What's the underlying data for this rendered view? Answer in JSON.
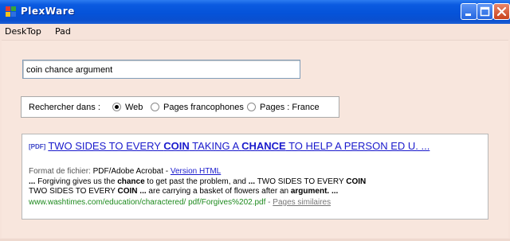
{
  "window": {
    "title": "PlexWare"
  },
  "menu": {
    "items": [
      "DeskTop",
      "Pad"
    ]
  },
  "search": {
    "value": "coin chance argument"
  },
  "search_in": {
    "label": "Rechercher dans :",
    "options": [
      {
        "label": "Web",
        "checked": true
      },
      {
        "label": "Pages francophones",
        "checked": false
      },
      {
        "label": "Pages : France",
        "checked": false
      }
    ]
  },
  "result": {
    "badge": "[PDF]",
    "title_parts": [
      {
        "text": "TWO SIDES TO EVERY ",
        "bold": false
      },
      {
        "text": "COIN",
        "bold": true
      },
      {
        "text": " TAKING A ",
        "bold": false
      },
      {
        "text": "CHANCE",
        "bold": true
      },
      {
        "text": " TO HELP A PERSON ED U. ...",
        "bold": false
      }
    ],
    "format_label": "Format de fichier:",
    "format_value": "PDF/Adobe Acrobat -",
    "version_link": "Version HTML",
    "snippet1_parts": [
      {
        "text": "... ",
        "bold": true
      },
      {
        "text": "Forgiving gives us the ",
        "bold": false
      },
      {
        "text": "chance",
        "bold": true
      },
      {
        "text": " to get past the problem, and ",
        "bold": false
      },
      {
        "text": "...",
        "bold": true
      },
      {
        "text": " TWO SIDES TO EVERY ",
        "bold": false
      },
      {
        "text": "COIN",
        "bold": true
      }
    ],
    "snippet2_parts": [
      {
        "text": "TWO SIDES TO EVERY ",
        "bold": false
      },
      {
        "text": "COIN",
        "bold": true
      },
      {
        "text": " ... ",
        "bold": true
      },
      {
        "text": "are carrying a basket of flowers after an ",
        "bold": false
      },
      {
        "text": "argument",
        "bold": true
      },
      {
        "text": ". ...",
        "bold": true
      }
    ],
    "url": "www.washtimes.com/education/charactered/ pdf/Forgives%202.pdf",
    "separator": "-",
    "similar_link": "Pages similaires"
  },
  "colors": {
    "titlebar": "#0553d9",
    "background": "#f7e4dc",
    "link": "#1a1acc",
    "url": "#1e8a1e"
  }
}
